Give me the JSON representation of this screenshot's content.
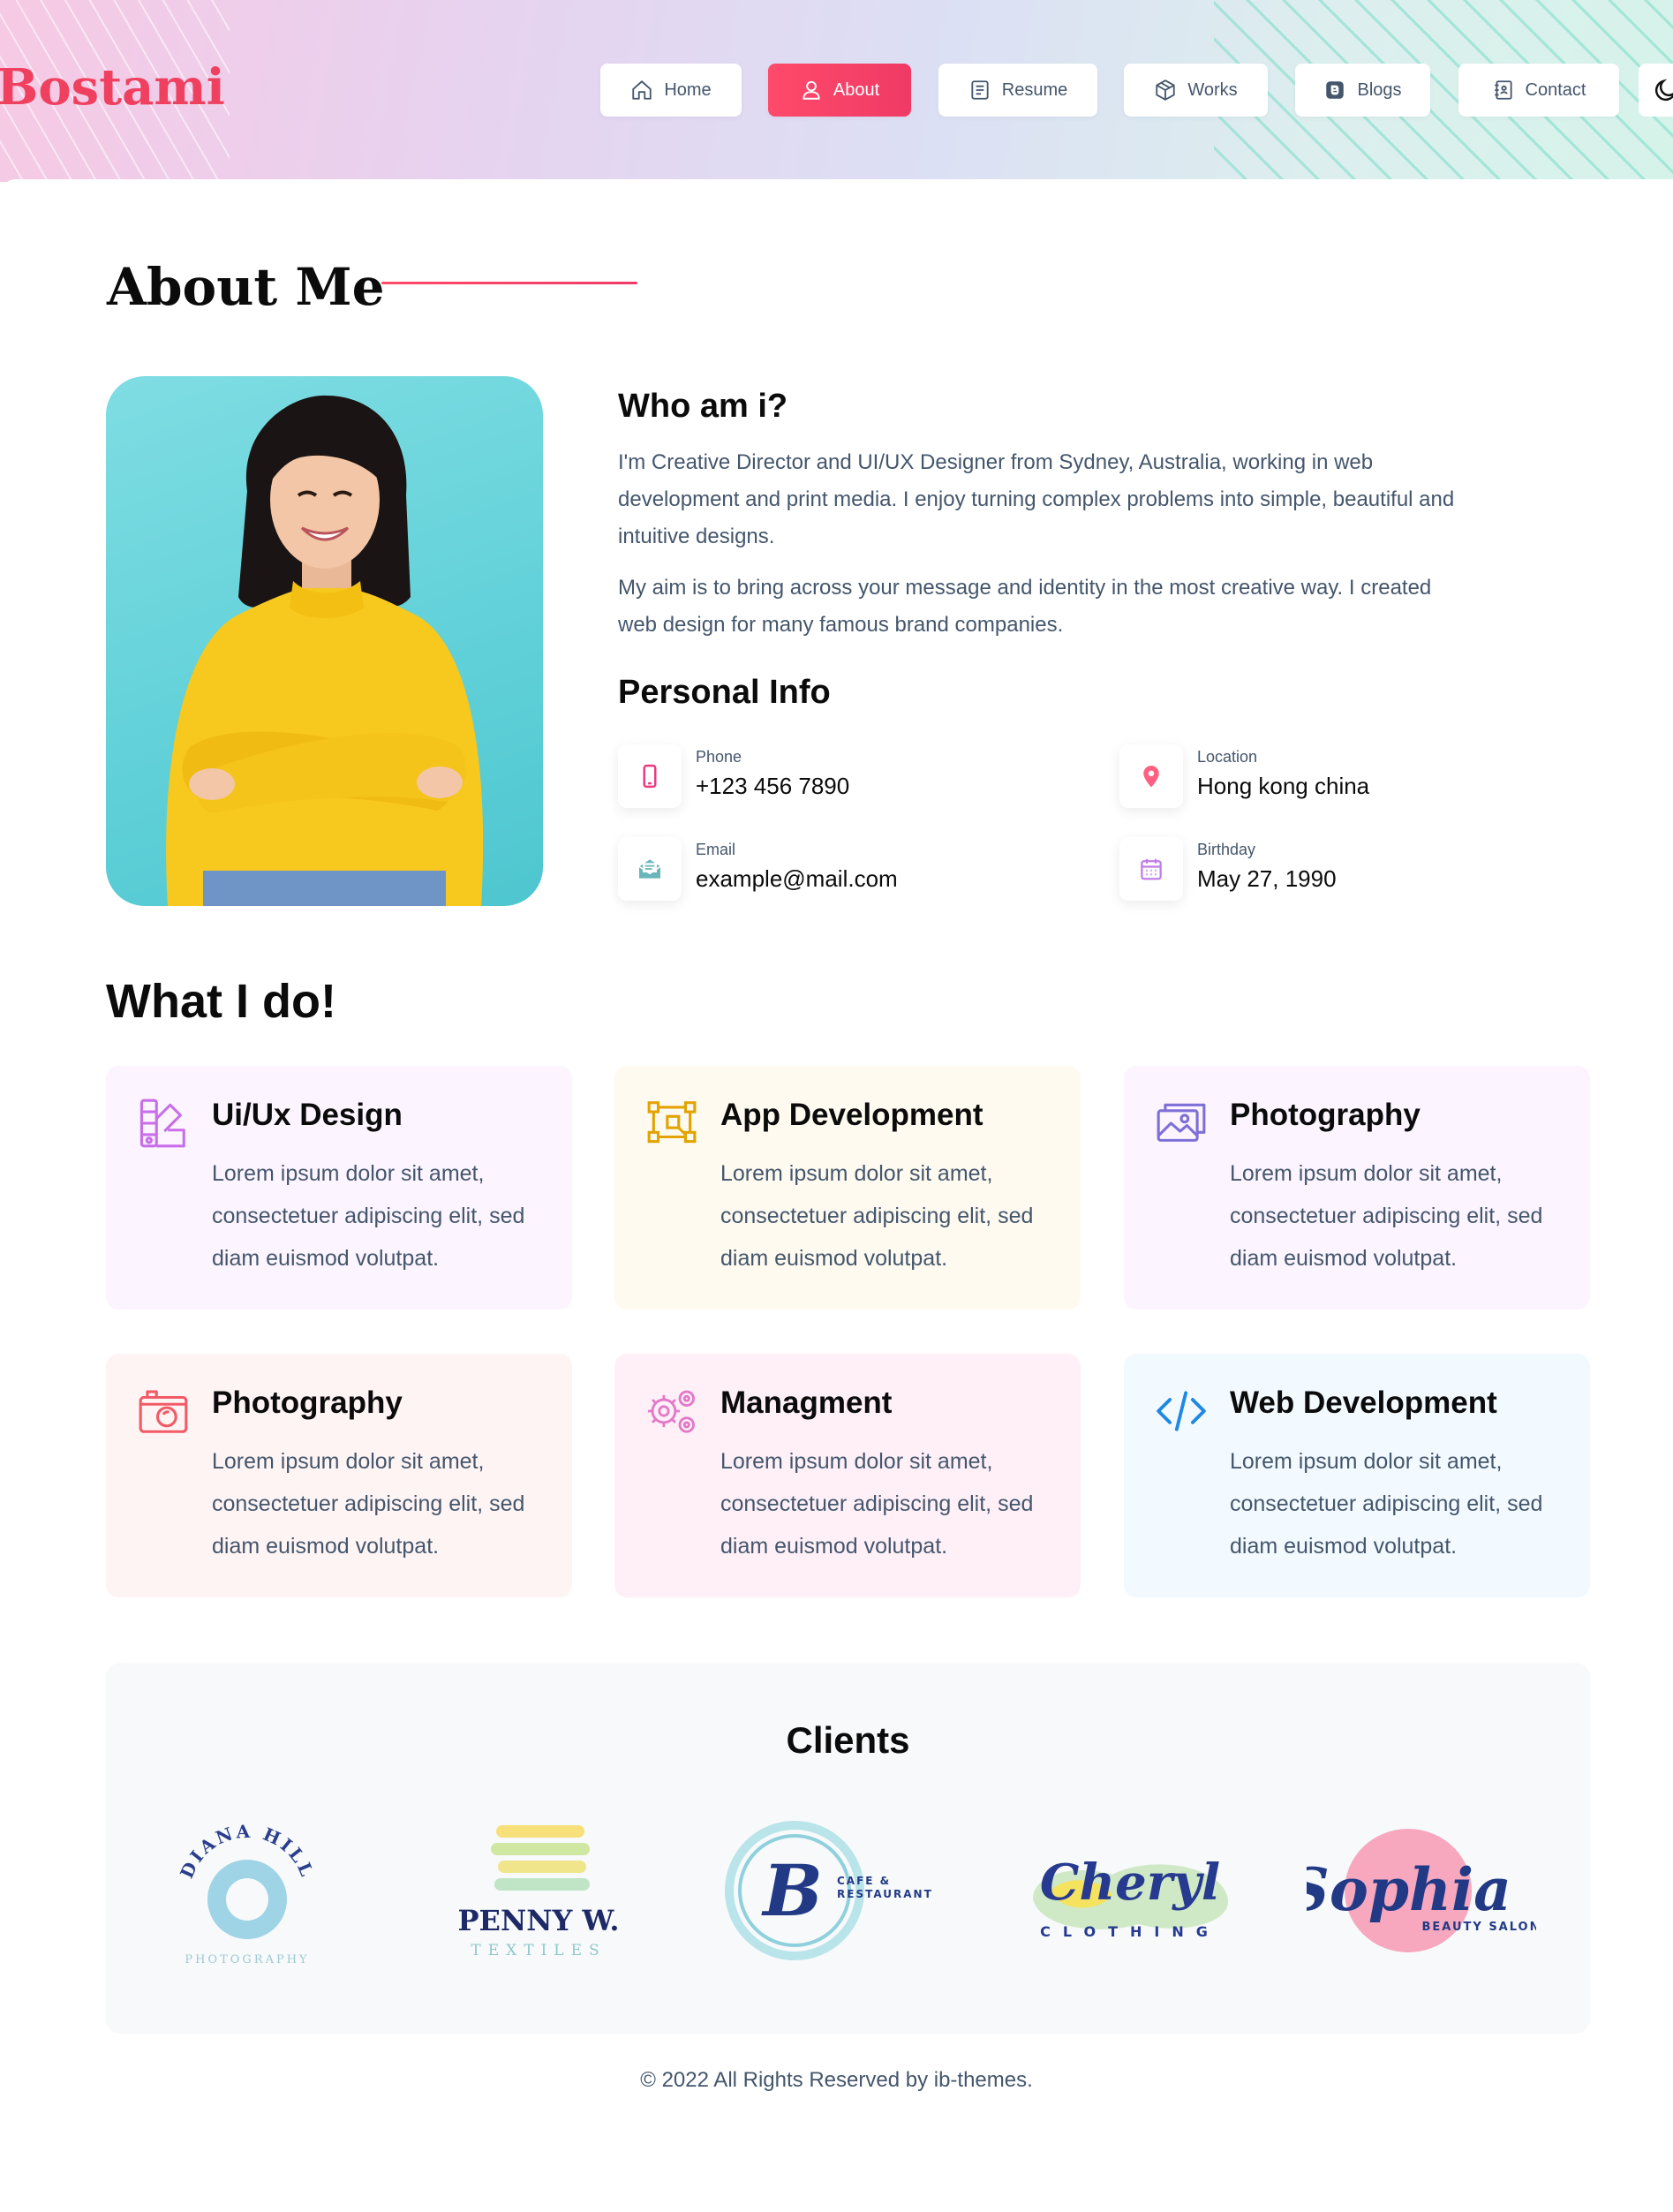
{
  "brand": {
    "logo_text": "Bostami"
  },
  "nav": {
    "items": [
      {
        "label": "Home",
        "icon": "home-icon",
        "active": false
      },
      {
        "label": "About",
        "icon": "user-icon",
        "active": true
      },
      {
        "label": "Resume",
        "icon": "file-icon",
        "active": false
      },
      {
        "label": "Works",
        "icon": "box-icon",
        "active": false
      },
      {
        "label": "Blogs",
        "icon": "blog-icon",
        "active": false
      },
      {
        "label": "Contact",
        "icon": "contact-icon",
        "active": false
      }
    ],
    "theme_icon": "moon-icon"
  },
  "about": {
    "section_title": "About Me",
    "who_title": "Who am i?",
    "paragraph_1": "I'm Creative Director and UI/UX Designer from Sydney, Australia, working in web development and print media. I enjoy turning complex problems into simple, beautiful and intuitive designs.",
    "paragraph_2": "My aim is to bring across your message and identity in the most creative way. I created web design for many famous brand companies.",
    "personal_info_title": "Personal Info",
    "personal_info": [
      {
        "label": "Phone",
        "value": "+123 456 7890",
        "icon": "phone-icon",
        "color": "#e93b81"
      },
      {
        "label": "Location",
        "value": "Hong kong china",
        "icon": "location-icon",
        "color": "#ff6080"
      },
      {
        "label": "Email",
        "value": "example@mail.com",
        "icon": "email-icon",
        "color": "#6ab5b9"
      },
      {
        "label": "Birthday",
        "value": "May 27, 1990",
        "icon": "calendar-icon",
        "color": "#c17ceb"
      }
    ]
  },
  "services": {
    "title": "What I do!",
    "items": [
      {
        "title": "Ui/Ux Design",
        "desc": "Lorem ipsum dolor sit amet, consectetuer adipiscing elit, sed diam euismod volutpat.",
        "icon": "design-icon",
        "bg": "#fcf4ff",
        "color": "#c86ee8"
      },
      {
        "title": "App Development",
        "desc": "Lorem ipsum dolor sit amet, consectetuer adipiscing elit, sed diam euismod volutpat.",
        "icon": "app-dev-icon",
        "bg": "#fefaf0",
        "color": "#e2a300"
      },
      {
        "title": "Photography",
        "desc": "Lorem ipsum dolor sit amet, consectetuer adipiscing elit, sed diam euismod volutpat.",
        "icon": "image-icon",
        "bg": "#fcf4ff",
        "color": "#7e6fd7"
      },
      {
        "title": "Photography",
        "desc": "Lorem ipsum dolor sit amet, consectetuer adipiscing elit, sed diam euismod volutpat.",
        "icon": "camera-icon",
        "bg": "#fff4f4",
        "color": "#f05b66"
      },
      {
        "title": "Managment",
        "desc": "Lorem ipsum dolor sit amet, consectetuer adipiscing elit, sed diam euismod volutpat.",
        "icon": "gears-icon",
        "bg": "#fff0f8",
        "color": "#e279c8"
      },
      {
        "title": "Web Development",
        "desc": "Lorem ipsum dolor sit amet, consectetuer adipiscing elit, sed diam euismod volutpat.",
        "icon": "code-icon",
        "bg": "#f3faff",
        "color": "#1e88e5"
      }
    ]
  },
  "clients": {
    "title": "Clients",
    "logos": [
      {
        "name": "DIANA HILL",
        "sub": "PHOTOGRAPHY"
      },
      {
        "name": "PENNY W.",
        "sub": "TEXTILES"
      },
      {
        "name": "B",
        "sub": "CAFE & RESTAURANT"
      },
      {
        "name": "Cheryl",
        "sub": "CLOTHING"
      },
      {
        "name": "Sophia",
        "sub": "BEAUTY SALON"
      }
    ]
  },
  "footer": {
    "text": "© 2022 All Rights Reserved by ib-themes."
  }
}
